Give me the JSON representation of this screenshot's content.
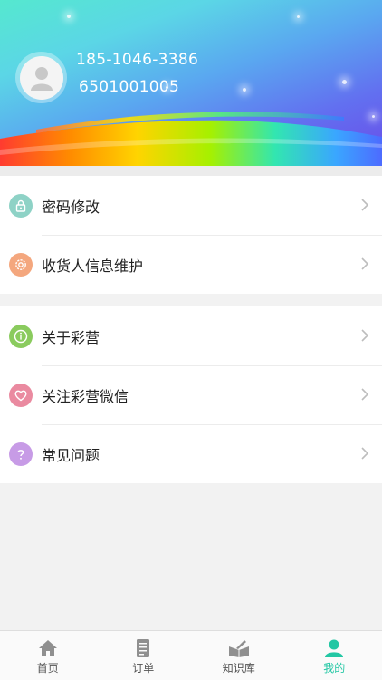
{
  "profile": {
    "phone": "185-1046-3386",
    "account": "6501001005"
  },
  "menu_group_1": [
    {
      "label": "密码修改",
      "icon": "lock-icon",
      "color": "#8ed2c6"
    },
    {
      "label": "收货人信息维护",
      "icon": "gear-icon",
      "color": "#f4a77e"
    }
  ],
  "menu_group_2": [
    {
      "label": "关于彩营",
      "icon": "info-icon",
      "color": "#8acb5e"
    },
    {
      "label": "关注彩营微信",
      "icon": "heart-icon",
      "color": "#ea8aa0"
    },
    {
      "label": "常见问题",
      "icon": "question-icon",
      "color": "#c79be6"
    }
  ],
  "tabs": [
    {
      "label": "首页",
      "icon": "home-icon"
    },
    {
      "label": "订单",
      "icon": "document-icon"
    },
    {
      "label": "知识库",
      "icon": "book-icon"
    },
    {
      "label": "我的",
      "icon": "person-icon",
      "active": true
    }
  ],
  "colors": {
    "accent": "#23c7a4",
    "icon_gray": "#8f8f8f"
  }
}
